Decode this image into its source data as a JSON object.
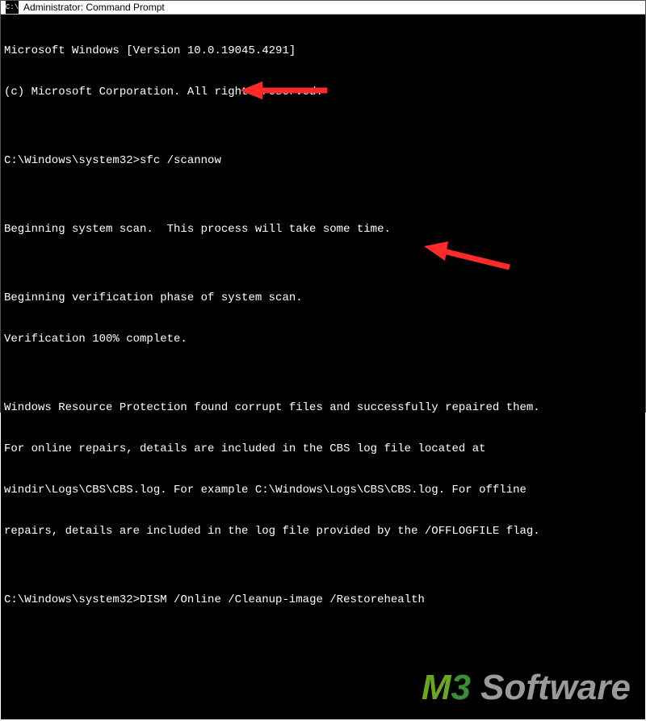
{
  "titlebar": {
    "icon_label": "C:\\",
    "title": "Administrator: Command Prompt"
  },
  "terminal": {
    "header1": "Microsoft Windows [Version 10.0.19045.4291]",
    "header2": "(c) Microsoft Corporation. All rights reserved.",
    "blank": "",
    "prompt1_prefix": "C:\\Windows\\system32>",
    "prompt1_cmd": "sfc /scannow",
    "scan_start": "Beginning system scan.  This process will take some time.",
    "verify1": "Beginning verification phase of system scan.",
    "verify2": "Verification 100% complete.",
    "res1": "Windows Resource Protection found corrupt files and successfully repaired them.",
    "res2": "For online repairs, details are included in the CBS log file located at",
    "res3": "windir\\Logs\\CBS\\CBS.log. For example C:\\Windows\\Logs\\CBS\\CBS.log. For offline",
    "res4": "repairs, details are included in the log file provided by the /OFFLOGFILE flag.",
    "prompt2_prefix": "C:\\Windows\\system32>",
    "prompt2_cmd": "DISM /Online /Cleanup-image /Restorehealth"
  },
  "annotations": {
    "arrow1_color": "#ff2a2a",
    "arrow2_color": "#ff2a2a"
  },
  "watermark": {
    "part1": "M",
    "part2": "3",
    "part3": " Software"
  }
}
